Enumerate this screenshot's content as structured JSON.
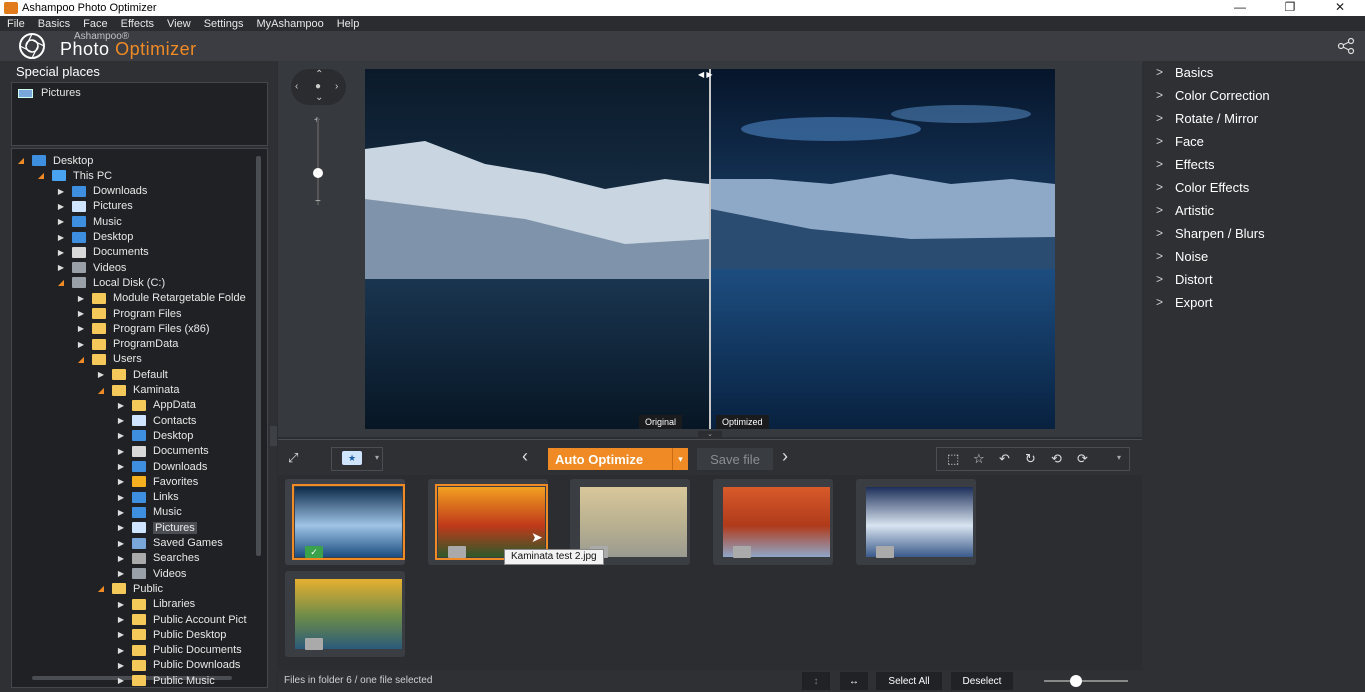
{
  "window": {
    "title": "Ashampoo Photo Optimizer",
    "minimize": "—",
    "maximize": "❐",
    "close": "✕"
  },
  "menu": [
    "File",
    "Basics",
    "Face",
    "Effects",
    "View",
    "Settings",
    "MyAshampoo",
    "Help"
  ],
  "brand": {
    "small": "Ashampoo®",
    "word1": "Photo",
    "word2": "Optimizer"
  },
  "left": {
    "heading": "Special places",
    "places": [
      "Pictures"
    ],
    "tree": [
      {
        "label": "Desktop",
        "depth": 0,
        "open": true,
        "icon": "desktop"
      },
      {
        "label": "This PC",
        "depth": 1,
        "open": true,
        "icon": "pc"
      },
      {
        "label": "Downloads",
        "depth": 2,
        "open": false,
        "icon": "download"
      },
      {
        "label": "Pictures",
        "depth": 2,
        "open": false,
        "icon": "pictures"
      },
      {
        "label": "Music",
        "depth": 2,
        "open": false,
        "icon": "music"
      },
      {
        "label": "Desktop",
        "depth": 2,
        "open": false,
        "icon": "desktop"
      },
      {
        "label": "Documents",
        "depth": 2,
        "open": false,
        "icon": "documents"
      },
      {
        "label": "Videos",
        "depth": 2,
        "open": false,
        "icon": "videos"
      },
      {
        "label": "Local Disk (C:)",
        "depth": 2,
        "open": true,
        "icon": "disk"
      },
      {
        "label": "Module Retargetable Folde",
        "depth": 3,
        "open": false,
        "icon": "folder"
      },
      {
        "label": "Program Files",
        "depth": 3,
        "open": false,
        "icon": "folder"
      },
      {
        "label": "Program Files (x86)",
        "depth": 3,
        "open": false,
        "icon": "folder"
      },
      {
        "label": "ProgramData",
        "depth": 3,
        "open": false,
        "icon": "folder"
      },
      {
        "label": "Users",
        "depth": 3,
        "open": true,
        "icon": "folder"
      },
      {
        "label": "Default",
        "depth": 4,
        "open": false,
        "icon": "folder"
      },
      {
        "label": "Kaminata",
        "depth": 4,
        "open": true,
        "icon": "folder"
      },
      {
        "label": "AppData",
        "depth": 5,
        "open": false,
        "icon": "folder"
      },
      {
        "label": "Contacts",
        "depth": 5,
        "open": false,
        "icon": "contacts"
      },
      {
        "label": "Desktop",
        "depth": 5,
        "open": false,
        "icon": "desktop"
      },
      {
        "label": "Documents",
        "depth": 5,
        "open": false,
        "icon": "documents"
      },
      {
        "label": "Downloads",
        "depth": 5,
        "open": false,
        "icon": "download"
      },
      {
        "label": "Favorites",
        "depth": 5,
        "open": false,
        "icon": "star"
      },
      {
        "label": "Links",
        "depth": 5,
        "open": false,
        "icon": "link"
      },
      {
        "label": "Music",
        "depth": 5,
        "open": false,
        "icon": "music"
      },
      {
        "label": "Pictures",
        "depth": 5,
        "open": false,
        "icon": "pictures",
        "selected": true
      },
      {
        "label": "Saved Games",
        "depth": 5,
        "open": false,
        "icon": "games"
      },
      {
        "label": "Searches",
        "depth": 5,
        "open": false,
        "icon": "search"
      },
      {
        "label": "Videos",
        "depth": 5,
        "open": false,
        "icon": "videos"
      },
      {
        "label": "Public",
        "depth": 4,
        "open": true,
        "icon": "folder"
      },
      {
        "label": "Libraries",
        "depth": 5,
        "open": false,
        "icon": "folder"
      },
      {
        "label": "Public Account Pict",
        "depth": 5,
        "open": false,
        "icon": "folder"
      },
      {
        "label": "Public Desktop",
        "depth": 5,
        "open": false,
        "icon": "folder"
      },
      {
        "label": "Public Documents",
        "depth": 5,
        "open": false,
        "icon": "folder"
      },
      {
        "label": "Public Downloads",
        "depth": 5,
        "open": false,
        "icon": "folder"
      },
      {
        "label": "Public Music",
        "depth": 5,
        "open": false,
        "icon": "folder"
      }
    ]
  },
  "viewer": {
    "original_label": "Original",
    "optimized_label": "Optimized"
  },
  "right": {
    "items": [
      "Basics",
      "Color Correction",
      "Rotate / Mirror",
      "Face",
      "Effects",
      "Color Effects",
      "Artistic",
      "Sharpen / Blurs",
      "Noise",
      "Distort",
      "Export"
    ]
  },
  "toolbar": {
    "auto_optimize": "Auto Optimize",
    "save_file": "Save file"
  },
  "thumbnails": [
    {
      "name": "thumb-1",
      "checked": true,
      "selected": true
    },
    {
      "name": "thumb-2",
      "checked": false,
      "highlighted": true
    },
    {
      "name": "thumb-3",
      "checked": false
    },
    {
      "name": "thumb-4",
      "checked": false
    },
    {
      "name": "thumb-5",
      "checked": false
    },
    {
      "name": "thumb-6",
      "checked": false
    }
  ],
  "tooltip": "Kaminata test 2.jpg",
  "status": {
    "text": "Files in folder 6 / one file selected",
    "select_all": "Select All",
    "deselect": "Deselect"
  },
  "colors": {
    "accent": "#f08a24",
    "panel": "#2e3034",
    "field": "#1f2124"
  }
}
